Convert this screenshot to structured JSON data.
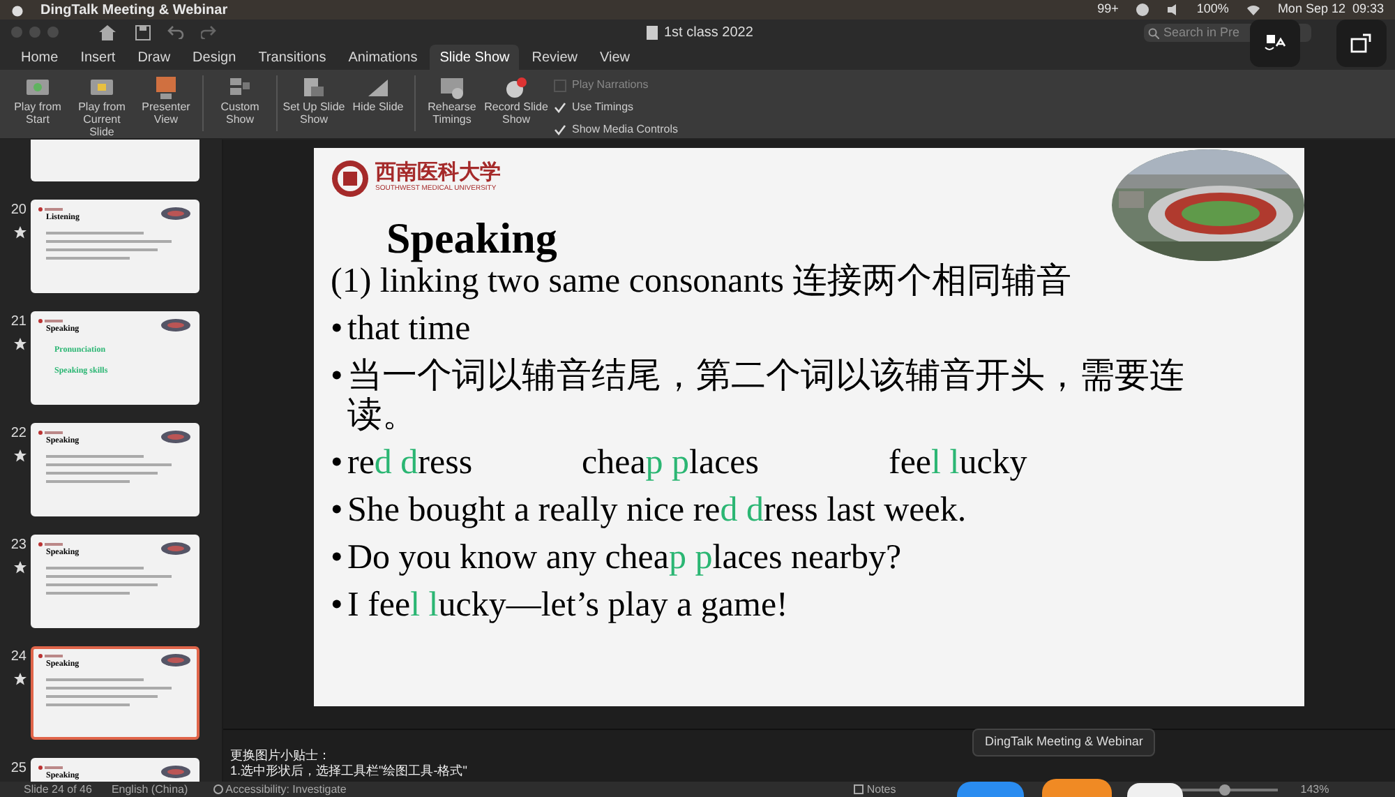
{
  "menu_bar": {
    "app": "DingTalk Meeting & Webinar",
    "badge": "99+",
    "battery": "100%",
    "clock": "Mon Sep 12  09:33"
  },
  "title_bar": {
    "title": "1st class 2022",
    "search": {
      "placeholder": "Search in Pre"
    }
  },
  "tabs": [
    {
      "label": "Home",
      "selected": false
    },
    {
      "label": "Insert",
      "selected": false
    },
    {
      "label": "Draw",
      "selected": false
    },
    {
      "label": "Design",
      "selected": false
    },
    {
      "label": "Transitions",
      "selected": false
    },
    {
      "label": "Animations",
      "selected": false
    },
    {
      "label": "Slide Show",
      "selected": true
    },
    {
      "label": "Review",
      "selected": false
    },
    {
      "label": "View",
      "selected": false
    }
  ],
  "ribbon": {
    "buttons": [
      {
        "label": "Play from Start"
      },
      {
        "label": "Play from Current Slide"
      },
      {
        "label": "Presenter View"
      },
      {
        "label": "Custom Show"
      },
      {
        "label": "Set Up Slide Show"
      },
      {
        "label": "Hide Slide"
      },
      {
        "label": "Rehearse Timings"
      },
      {
        "label": "Record Slide Show"
      }
    ],
    "checkboxes": [
      {
        "label": "Play Narrations",
        "checked": false
      },
      {
        "label": "Use Timings",
        "checked": true
      },
      {
        "label": "Show Media Controls",
        "checked": true
      }
    ]
  },
  "thumbnails": [
    {
      "number": "20",
      "title": "Listening",
      "selected": false
    },
    {
      "number": "21",
      "title": "Speaking",
      "lines": [
        "Pronunciation",
        "Speaking skills"
      ],
      "selected": false
    },
    {
      "number": "22",
      "title": "Speaking",
      "selected": false
    },
    {
      "number": "23",
      "title": "Speaking",
      "selected": false
    },
    {
      "number": "24",
      "title": "Speaking",
      "selected": true
    },
    {
      "number": "25",
      "title": "Speaking",
      "selected": false
    }
  ],
  "slide": {
    "logo": "西南医科大学",
    "logo_sub": "SOUTHWEST MEDICAL UNIVERSITY",
    "title": "Speaking",
    "subtitle": "(1) linking two same consonants 连接两个相同辅音",
    "bullets": [
      {
        "kind": "text",
        "marker": "•",
        "segments": [
          {
            "text": "that time",
            "hl": false
          }
        ]
      },
      {
        "kind": "text",
        "marker": "•",
        "segments": [
          {
            "text": "当一个词以辅音结尾，第二个词以该辅音开头，需要连读。",
            "hl": false
          }
        ]
      },
      {
        "kind": "columns",
        "marker": "•",
        "items": [
          [
            {
              "text": "re",
              "hl": false
            },
            {
              "text": "d",
              "hl": true
            },
            {
              "text": " d",
              "hl": true
            },
            {
              "text": "ress",
              "hl": false
            }
          ],
          [
            {
              "text": "chea",
              "hl": false
            },
            {
              "text": "p",
              "hl": true
            },
            {
              "text": " p",
              "hl": true
            },
            {
              "text": "laces",
              "hl": false
            }
          ],
          [
            {
              "text": "fee",
              "hl": false
            },
            {
              "text": "l",
              "hl": true
            },
            {
              "text": " l",
              "hl": true
            },
            {
              "text": "ucky",
              "hl": false
            }
          ]
        ]
      },
      {
        "kind": "text",
        "marker": "•",
        "segments": [
          {
            "text": "She bought a really nice re",
            "hl": false
          },
          {
            "text": "d",
            "hl": true
          },
          {
            "text": " d",
            "hl": true
          },
          {
            "text": "ress last week.",
            "hl": false
          }
        ]
      },
      {
        "kind": "text",
        "marker": "•",
        "segments": [
          {
            "text": "Do you know any chea",
            "hl": false
          },
          {
            "text": "p",
            "hl": true
          },
          {
            "text": " p",
            "hl": true
          },
          {
            "text": "laces nearby?",
            "hl": false
          }
        ]
      },
      {
        "kind": "text",
        "marker": "•",
        "segments": [
          {
            "text": "I fee",
            "hl": false
          },
          {
            "text": "l",
            "hl": true
          },
          {
            "text": " l",
            "hl": true
          },
          {
            "text": "ucky—let’s play a game!",
            "hl": false
          }
        ]
      }
    ]
  },
  "notes": [
    "更换图片小贴士：",
    "1.选中形状后，选择工具栏\"绘图工具-格式\""
  ],
  "tooltip": "DingTalk Meeting & Webinar",
  "status_bar": {
    "slide": "Slide 24 of 46",
    "language": "English (China)",
    "accessibility": "Accessibility: Investigate",
    "notes": "Notes",
    "zoom_slider": {
      "level": 0.45
    },
    "zoom": "143%"
  }
}
